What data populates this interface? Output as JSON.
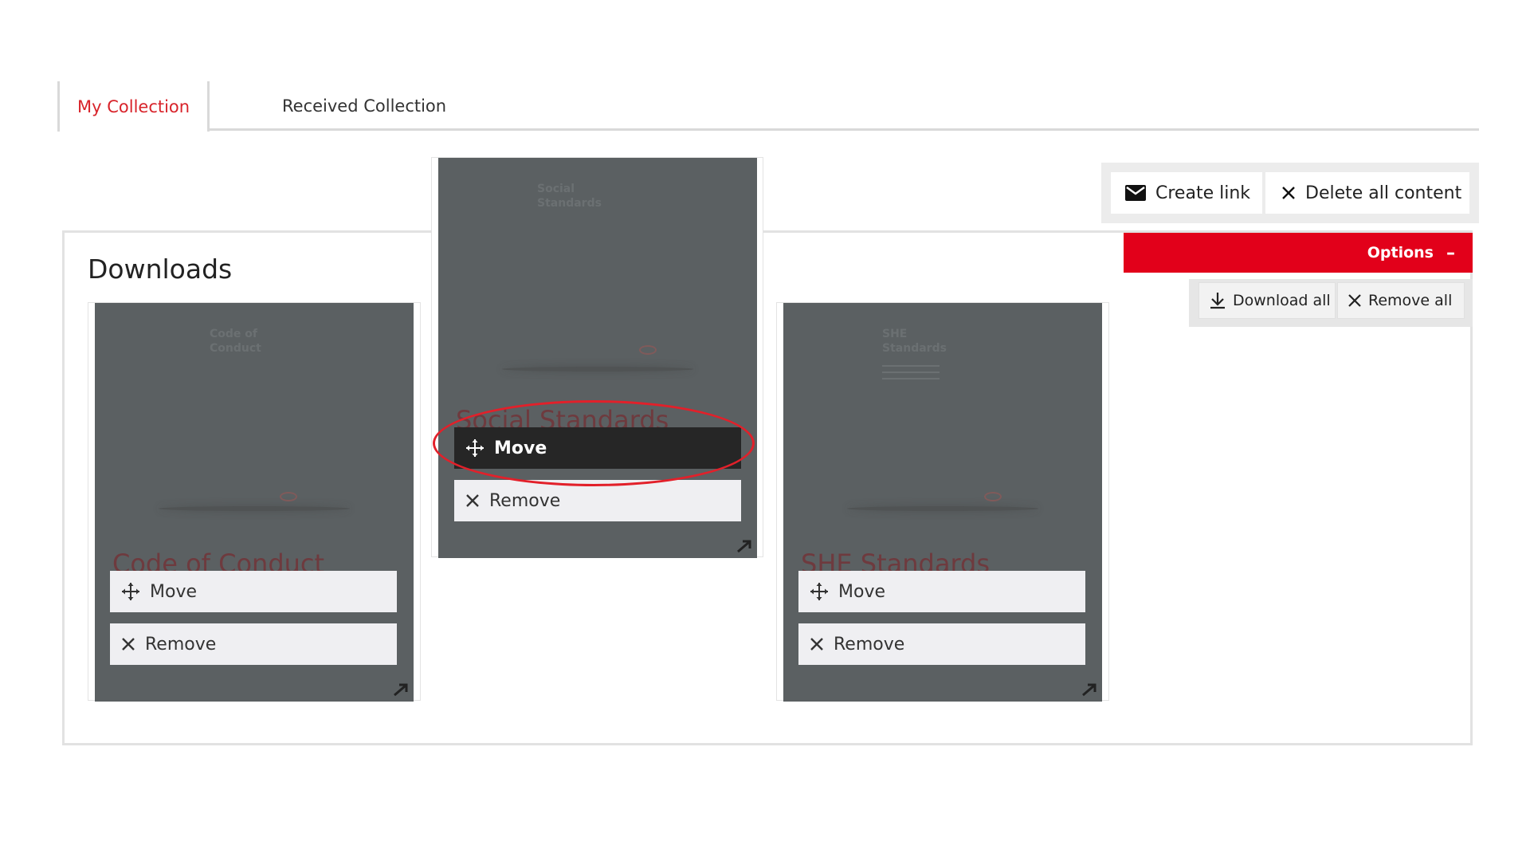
{
  "tabs": [
    {
      "label": "My Collection",
      "active": true
    },
    {
      "label": "Received Collection",
      "active": false
    }
  ],
  "actions": {
    "create_link": "Create link",
    "delete_all": "Delete all content"
  },
  "options": {
    "label": "Options",
    "toggle": "–",
    "download_all": "Download all",
    "remove_all": "Remove all"
  },
  "panel": {
    "title": "Downloads"
  },
  "cards": [
    {
      "name": "Code of Conduct",
      "cover_title_line1": "Code of",
      "cover_title_line2": "Conduct",
      "move_label": "Move",
      "remove_label": "Remove"
    },
    {
      "name": "Social Standards",
      "cover_title_line1": "Social",
      "cover_title_line2": "Standards",
      "move_label": "Move",
      "remove_label": "Remove",
      "dragging": true
    },
    {
      "name": "SHE Standards",
      "cover_title_line1": "SHE",
      "cover_title_line2": "Standards",
      "move_label": "Move",
      "remove_label": "Remove"
    }
  ],
  "colors": {
    "accent": "#e2001a",
    "active_tab": "#d8232a",
    "cover": "#5b6062",
    "dark_button": "#262626"
  }
}
